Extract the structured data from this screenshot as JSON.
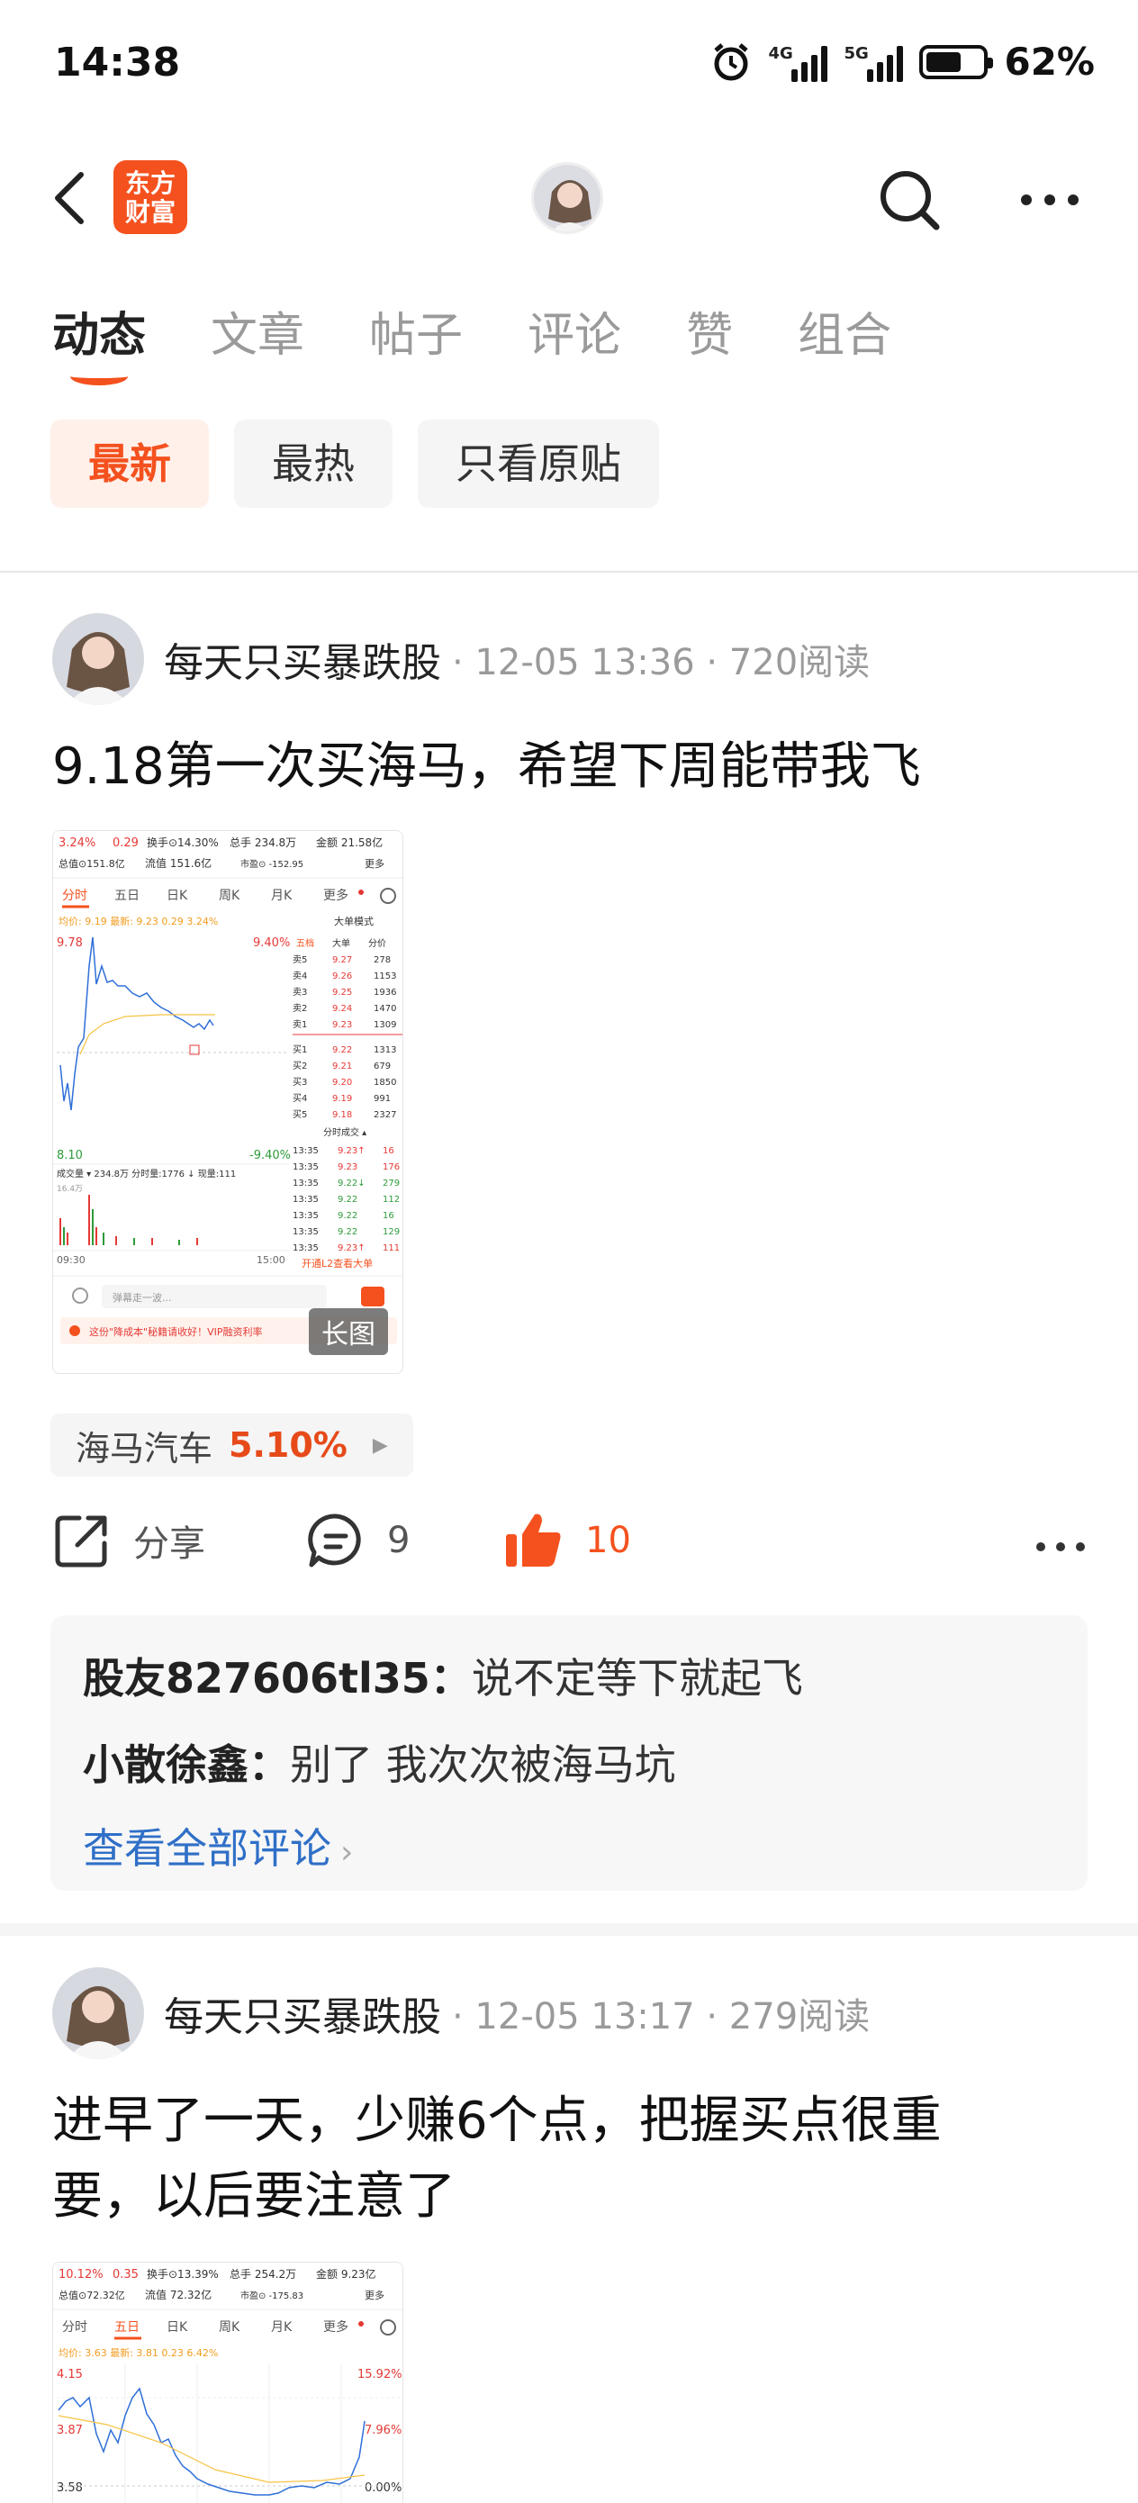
{
  "status_bar": {
    "time": "14:38",
    "net1": "4G",
    "net2": "5G",
    "battery": "62%",
    "battery_level": 0.62
  },
  "header": {
    "logo_line1": "东方",
    "logo_line2": "财富"
  },
  "tabs": [
    {
      "label": "动态",
      "active": true
    },
    {
      "label": "文章",
      "active": false
    },
    {
      "label": "帖子",
      "active": false
    },
    {
      "label": "评论",
      "active": false
    },
    {
      "label": "赞",
      "active": false
    },
    {
      "label": "组合",
      "active": false
    }
  ],
  "filters": [
    {
      "label": "最新",
      "active": true
    },
    {
      "label": "最热",
      "active": false
    },
    {
      "label": "只看原贴",
      "active": false
    }
  ],
  "posts": [
    {
      "author": "每天只买暴跌股",
      "meta": "· 12-05 13:36 · 720阅读",
      "title": "9.18第一次买海马，希望下周能带我飞",
      "image_tag": "长图",
      "chart": {
        "pct": "3.24%",
        "chg": "0.29",
        "turnover": "换手⊙14.30%",
        "volume": "总手 234.8万",
        "amount": "金额 21.58亿",
        "total_mv": "总值⊙151.8亿",
        "float_mv": "流值 151.6亿",
        "pe": "市盈⊙ -152.95",
        "more": "更多",
        "periods": [
          "分时",
          "五日",
          "日K",
          "周K",
          "月K",
          "更多"
        ],
        "avg_line": "均价: 9.19 最新: 9.23 0.29 3.24%",
        "mode": "大单模式",
        "y_high": "9.78",
        "y_high_pct": "9.40%",
        "y_low": "8.10",
        "y_low_pct": "-9.40%",
        "vol_label": "成交量 ▾ 234.8万   分时量:1776 ↓   现量:111",
        "vol_max": "16.4万",
        "time_start": "09:30",
        "time_end": "15:00",
        "order_tabs": [
          "五档",
          "大单",
          "分价"
        ],
        "asks": [
          [
            "卖5",
            "9.27",
            "278"
          ],
          [
            "卖4",
            "9.26",
            "1153"
          ],
          [
            "卖3",
            "9.25",
            "1936"
          ],
          [
            "卖2",
            "9.24",
            "1470"
          ],
          [
            "卖1",
            "9.23",
            "1309"
          ]
        ],
        "bids": [
          [
            "买1",
            "9.22",
            "1313"
          ],
          [
            "买2",
            "9.21",
            "679"
          ],
          [
            "买3",
            "9.20",
            "1850"
          ],
          [
            "买4",
            "9.19",
            "991"
          ],
          [
            "买5",
            "9.18",
            "2327"
          ]
        ],
        "trades_title": "分时成交 ▴",
        "trades": [
          [
            "13:35",
            "9.23↑",
            "16"
          ],
          [
            "13:35",
            "9.23",
            "176"
          ],
          [
            "13:35",
            "9.22↓",
            "279"
          ],
          [
            "13:35",
            "9.22",
            "112"
          ],
          [
            "13:35",
            "9.22",
            "16"
          ],
          [
            "13:35",
            "9.22",
            "129"
          ],
          [
            "13:35",
            "9.23↑",
            "111"
          ]
        ],
        "l2": "开通L2查看大单",
        "comment_box": "弹幕走一波...",
        "notice": "这份\"降成本\"秘籍请收好！VIP融资利率"
      },
      "stock": {
        "name": "海马汽车",
        "change": "5.10%"
      },
      "share_label": "分享",
      "comment_count": "9",
      "like_count": "10",
      "comments": [
        {
          "user": "股友827606tl35：",
          "text": "说不定等下就起飞"
        },
        {
          "user": "小散徐鑫：",
          "text": "别了 我次次被海马坑"
        }
      ],
      "view_all": "查看全部评论"
    },
    {
      "author": "每天只买暴跌股",
      "meta": "· 12-05 13:17 · 279阅读",
      "title_line1": "进早了一天，少赚6个点，把握买点很重",
      "title_line2": "要，以后要注意了",
      "chart": {
        "pct": "10.12%",
        "chg": "0.35",
        "turnover": "换手⊙13.39%",
        "volume": "总手 254.2万",
        "amount": "金额 9.23亿",
        "total_mv": "总值⊙72.32亿",
        "float_mv": "流值 72.32亿",
        "pe": "市盈⊙ -175.83",
        "more": "更多",
        "periods": [
          "分时",
          "五日",
          "日K",
          "周K",
          "月K",
          "更多"
        ],
        "avg_line": "均价: 3.63 最新: 3.81 0.23 6.42%",
        "y_high": "4.15",
        "y_high_pct": "15.92%",
        "y_mid": "3.87",
        "y_mid_pct": "7.96%",
        "y_low": "3.58",
        "y_low_pct": "0.00%"
      }
    }
  ]
}
